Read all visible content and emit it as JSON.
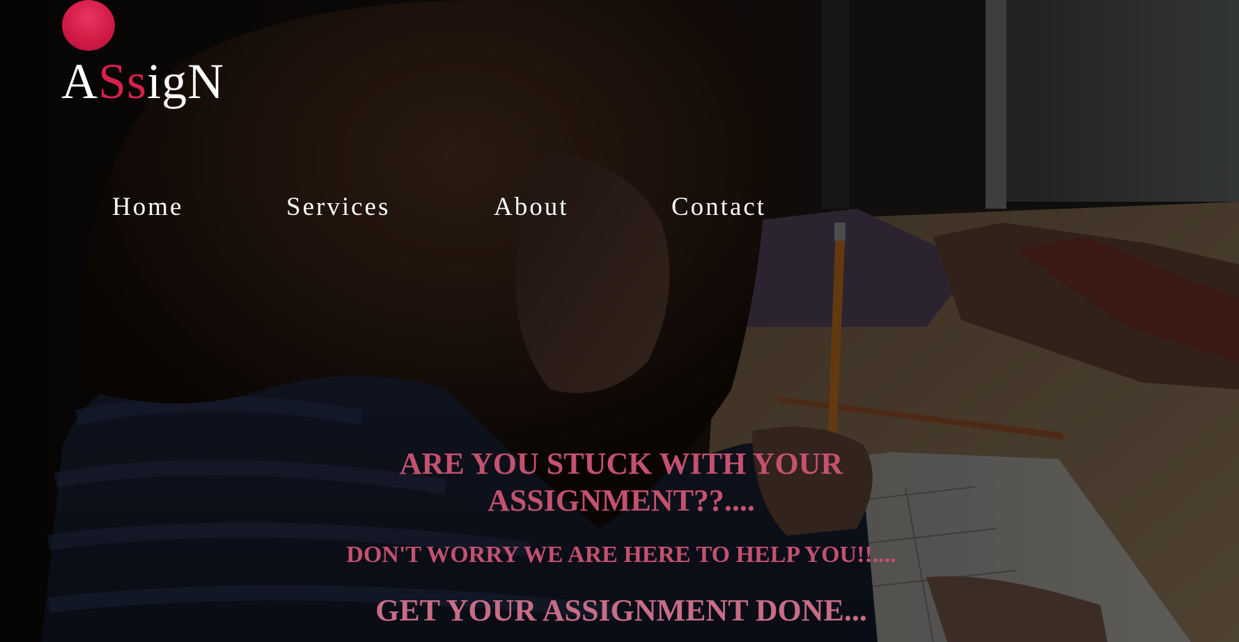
{
  "brand": {
    "logo_part1": "A",
    "logo_accent": "Ss",
    "logo_part2": "igN",
    "accent_color": "#d8204c"
  },
  "nav": {
    "items": [
      {
        "label": "Home"
      },
      {
        "label": "Services"
      },
      {
        "label": "About"
      },
      {
        "label": "Contact"
      }
    ]
  },
  "hero": {
    "headline": "ARE YOU STUCK WITH YOUR ASSIGNMENT??....",
    "subheadline": "DON'T WORRY WE ARE HERE TO HELP YOU!!....",
    "cta_text": "GET YOUR ASSIGNMENT DONE...",
    "text_color": "#c4516f"
  }
}
